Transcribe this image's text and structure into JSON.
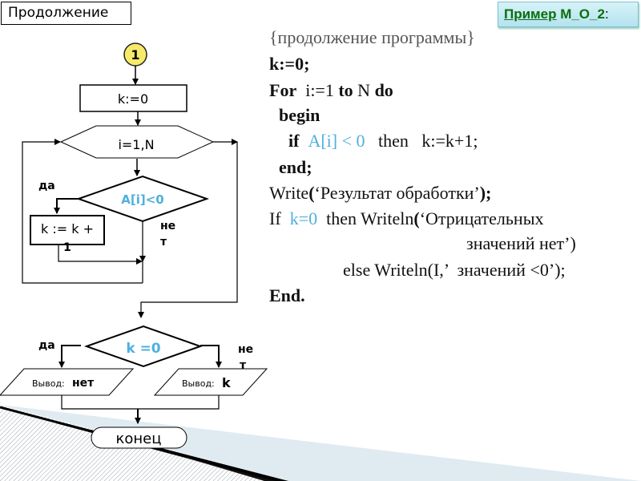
{
  "header": {
    "title": "Продолжение",
    "example_link": "Пример",
    "example_rest": " М_О_2",
    "example_colon": ":"
  },
  "flowchart": {
    "connector_label": "1",
    "init_block": "k:=0",
    "loop_block": "i=1,N",
    "condition1": "A[i]<0",
    "condition1_yes": "да",
    "condition1_no_line1": "не",
    "condition1_no_line2": "т",
    "increment_line1": "k := k +",
    "increment_line2": "1",
    "condition2": "k =0",
    "condition2_yes": "да",
    "condition2_no_line1": "не",
    "condition2_no_line2": "т",
    "output_left_prefix": "Вывод:",
    "output_left_value": "нет",
    "output_right_prefix": "Вывод:",
    "output_right_value": "k",
    "end_block": "конец"
  },
  "code": {
    "comment": "{продолжение программы}",
    "line_k0": "k:=0;",
    "for_kw": "For",
    "for_mid": "  i:=1 ",
    "to_kw": "to",
    "for_n": " N ",
    "do_kw": "do",
    "begin_kw": "begin",
    "if_kw": "if",
    "if_cond": "A[i] < 0",
    "if_then": "   then   k:=k+1;",
    "end_kw": "end;",
    "write_fn": "Write",
    "write_open": "(",
    "write_arg": "‘Результат обработки’",
    "write_close": ");",
    "if2_kw": "If  ",
    "if2_cond": "k=0",
    "if2_then": "  then Writeln",
    "if2_open": "(",
    "if2_arg": "‘Отрицательных",
    "if2_cont": "значений нет’)",
    "else_line": "else Writeln(I,’  значений <0’);",
    "end_final": "End."
  },
  "colors": {
    "highlight": "#4fb0dd",
    "link_green": "#0b6e0b",
    "connector_fill": "#f7ea6a"
  }
}
